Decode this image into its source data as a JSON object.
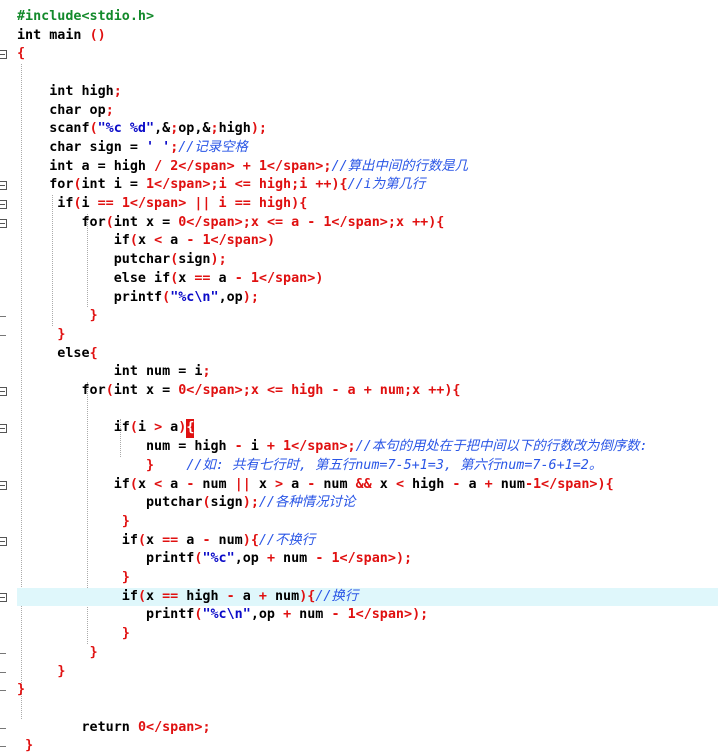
{
  "editor": {
    "highlight_line": 31,
    "lines": [
      {
        "text": "#include<stdio.h>",
        "kind": "preprocessor"
      },
      {
        "text": "int main ()"
      },
      {
        "text": "{"
      },
      {
        "text": ""
      },
      {
        "text": "    int high;"
      },
      {
        "text": "    char op;"
      },
      {
        "text": "    scanf(\"%c %d\",&op,&high);"
      },
      {
        "text": "    char sign = ' ';//记录空格"
      },
      {
        "text": "    int a = high / 2 + 1;//算出中间的行数是几"
      },
      {
        "text": "    for(int i = 1;i <= high;i ++){//i为第几行"
      },
      {
        "text": "     if(i == 1 || i == high){"
      },
      {
        "text": "        for(int x = 0;x <= a - 1;x ++){"
      },
      {
        "text": "            if(x < a - 1)"
      },
      {
        "text": "            putchar(sign);"
      },
      {
        "text": "            else if(x == a - 1)"
      },
      {
        "text": "            printf(\"%c\\n\",op);"
      },
      {
        "text": "         }"
      },
      {
        "text": "     }"
      },
      {
        "text": "     else{"
      },
      {
        "text": "            int num = i;"
      },
      {
        "text": "        for(int x = 0;x <= high - a + num;x ++){"
      },
      {
        "text": ""
      },
      {
        "text": "            if(i > a){"
      },
      {
        "text": "                num = high - i + 1;//本句的用处在于把中间以下的行数改为倒序数:"
      },
      {
        "text": "                }    //如: 共有七行时, 第五行num=7-5+1=3, 第六行num=7-6+1=2。"
      },
      {
        "text": "            if(x < a - num || x > a - num && x < high - a + num-1){"
      },
      {
        "text": "                putchar(sign);//各种情况讨论"
      },
      {
        "text": "             }"
      },
      {
        "text": "             if(x == a - num){//不换行"
      },
      {
        "text": "                printf(\"%c\",op + num - 1);"
      },
      {
        "text": "             }"
      },
      {
        "text": "             if(x == high - a + num){//换行"
      },
      {
        "text": "                printf(\"%c\\n\",op + num - 1);"
      },
      {
        "text": "             }"
      },
      {
        "text": "         }"
      },
      {
        "text": "     }"
      },
      {
        "text": "}"
      },
      {
        "text": ""
      },
      {
        "text": "        return 0;"
      },
      {
        "text": " }"
      }
    ]
  }
}
